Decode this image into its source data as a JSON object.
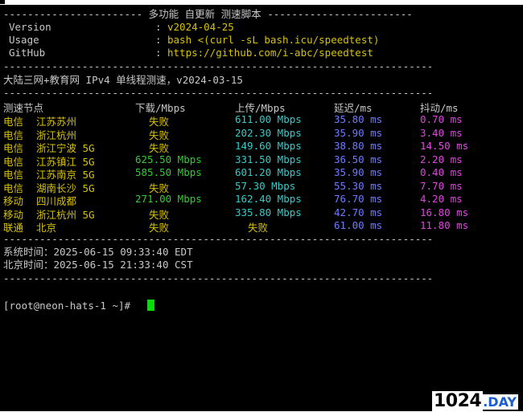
{
  "header": {
    "sep_left": "-----------------------",
    "title": "多功能 自更新 测速脚本",
    "sep_right": "------------------------",
    "version_label": "Version",
    "version_value": "v2024-04-25",
    "usage_label": "Usage",
    "usage_value": "bash <(curl -sL bash.icu/speedtest)",
    "github_label": "GitHub",
    "github_value": "https://github.com/i-abc/speedtest"
  },
  "separator": "-----------------------------------------------------------------------",
  "mode_line": "大陆三网+教育网 IPv4 单线程测速，v2024-03-15",
  "columns": [
    "测速节点",
    "下载/Mbps",
    "上传/Mbps",
    "延迟/ms",
    "抖动/ms"
  ],
  "rows": [
    {
      "isp": "电信",
      "node": "江苏苏州",
      "download": "失败",
      "upload": "611.00 Mbps",
      "latency": "35.80 ms",
      "jitter": "0.70 ms"
    },
    {
      "isp": "电信",
      "node": "浙江杭州",
      "download": "失败",
      "upload": "202.30 Mbps",
      "latency": "35.90 ms",
      "jitter": "3.40 ms"
    },
    {
      "isp": "电信",
      "node": "浙江宁波 5G",
      "download": "失败",
      "upload": "149.60 Mbps",
      "latency": "38.80 ms",
      "jitter": "14.50 ms"
    },
    {
      "isp": "电信",
      "node": "江苏镇江 5G",
      "download": "625.50 Mbps",
      "upload": "331.50 Mbps",
      "latency": "36.50 ms",
      "jitter": "2.20 ms"
    },
    {
      "isp": "电信",
      "node": "江苏南京 5G",
      "download": "585.50 Mbps",
      "upload": "601.20 Mbps",
      "latency": "35.90 ms",
      "jitter": "0.40 ms"
    },
    {
      "isp": "电信",
      "node": "湖南长沙 5G",
      "download": "失败",
      "upload": "57.30 Mbps",
      "latency": "55.30 ms",
      "jitter": "7.70 ms"
    },
    {
      "isp": "移动",
      "node": "四川成都",
      "download": "271.00 Mbps",
      "upload": "162.40 Mbps",
      "latency": "76.70 ms",
      "jitter": "4.20 ms"
    },
    {
      "isp": "移动",
      "node": "浙江杭州 5G",
      "download": "失败",
      "upload": "335.80 Mbps",
      "latency": "42.70 ms",
      "jitter": "16.80 ms"
    },
    {
      "isp": "联通",
      "node": "北京",
      "download": "失败",
      "upload": "失败",
      "latency": "61.00 ms",
      "jitter": "11.80 ms"
    }
  ],
  "system_time": "系统时间：2025-06-15 09:33:40 EDT",
  "beijing_time": "北京时间：2025-06-15 21:33:40 CST",
  "prompt": "[root@neon-hats-1 ~]#",
  "watermark": {
    "num": "1024",
    "day": ".DAY"
  },
  "colors": {
    "background": "#000000",
    "green": "#33cc33",
    "yellow": "#d7c200",
    "cyan": "#33cccc",
    "blue": "#6f7cff",
    "magenta": "#e045e0",
    "cursor": "#00e000"
  }
}
